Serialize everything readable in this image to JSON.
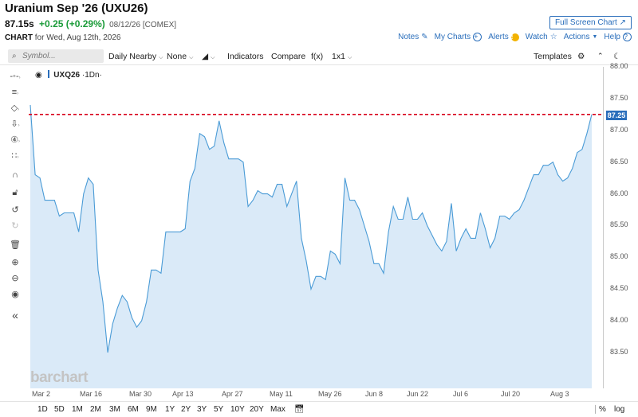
{
  "header": {
    "title": "Uranium Sep '26 (UXU26)",
    "last": "87.15s",
    "change": "+0.25 (+0.29%)",
    "meta": "08/12/26 [COMEX]",
    "fullscreen_label": "Full Screen Chart"
  },
  "subheader": {
    "chart_label": "CHART",
    "date_text": "for Wed, Aug 12th, 2026",
    "notes": "Notes",
    "my_charts": "My Charts",
    "alerts": "Alerts",
    "watch": "Watch",
    "actions": "Actions",
    "help": "Help"
  },
  "toolbar": {
    "search_placeholder": "Symbol...",
    "interval": "Daily Nearby",
    "overlay": "None",
    "indicators": "Indicators",
    "compare": "Compare",
    "fx": "f(x)",
    "layout": "1x1",
    "templates": "Templates"
  },
  "legend": {
    "symbol": "UXQ26",
    "period": "·1Dn·"
  },
  "current_price_label": "87.25",
  "watermark": "barchart",
  "ranges": [
    "1D",
    "5D",
    "1M",
    "2M",
    "3M",
    "6M",
    "9M",
    "1Y",
    "2Y",
    "3Y",
    "5Y",
    "10Y",
    "20Y",
    "Max"
  ],
  "bottom_right": {
    "percent": "%",
    "log": "log"
  },
  "colors": {
    "line": "#4a9bd6",
    "fill": "#d3e6f7",
    "refline": "#d8001a",
    "accent": "#2a6ebb",
    "up": "#1a9b38"
  },
  "chart_data": {
    "type": "area",
    "title": "",
    "xlabel": "",
    "ylabel": "",
    "ylim": [
      83.3,
      88.0
    ],
    "y_ticks": [
      "88.00",
      "87.50",
      "87.00",
      "86.50",
      "86.00",
      "85.50",
      "85.00",
      "84.50",
      "84.00",
      "83.50"
    ],
    "x_ticks": [
      "Mar 2",
      "Mar 16",
      "Mar 30",
      "Apr 13",
      "Apr 27",
      "May 11",
      "May 26",
      "Jun 8",
      "Jun 22",
      "Jul 6",
      "Jul 20",
      "Aug 3"
    ],
    "reference_line": 87.25,
    "series": [
      {
        "values": [
          87.4,
          86.3,
          86.25,
          85.9,
          85.9,
          85.9,
          85.65,
          85.7,
          85.7,
          85.7,
          85.4,
          86.0,
          86.25,
          86.15,
          84.8,
          84.3,
          83.5,
          83.95,
          84.2,
          84.4,
          84.3,
          84.05,
          83.9,
          84.0,
          84.3,
          84.8,
          84.8,
          84.75,
          85.4,
          85.4,
          85.4,
          85.4,
          85.45,
          86.2,
          86.4,
          86.95,
          86.9,
          86.7,
          86.75,
          87.15,
          86.8,
          86.55,
          86.55,
          86.55,
          86.5,
          85.8,
          85.9,
          86.05,
          86.0,
          86.0,
          85.95,
          86.15,
          86.15,
          85.8,
          86.0,
          86.2,
          85.3,
          84.95,
          84.5,
          84.7,
          84.7,
          84.65,
          85.1,
          85.05,
          84.9,
          86.25,
          85.9,
          85.9,
          85.75,
          85.5,
          85.25,
          84.9,
          84.9,
          84.75,
          85.4,
          85.8,
          85.6,
          85.6,
          85.95,
          85.6,
          85.6,
          85.7,
          85.5,
          85.35,
          85.2,
          85.1,
          85.25,
          85.85,
          85.1,
          85.3,
          85.45,
          85.3,
          85.3,
          85.7,
          85.45,
          85.15,
          85.3,
          85.65,
          85.65,
          85.6,
          85.7,
          85.75,
          85.9,
          86.1,
          86.3,
          86.3,
          86.45,
          86.45,
          86.5,
          86.3,
          86.2,
          86.25,
          86.4,
          86.65,
          86.7,
          86.95,
          87.25
        ]
      }
    ]
  }
}
